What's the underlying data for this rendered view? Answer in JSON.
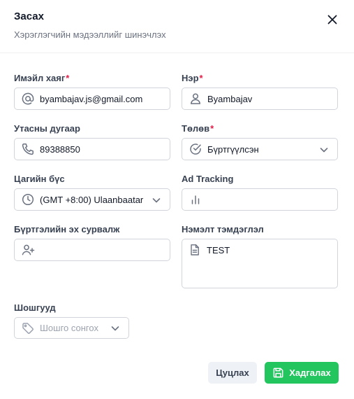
{
  "dialog": {
    "title": "Засах",
    "subtitle": "Хэрэглэгчийн мэдээллийг шинэчлэх"
  },
  "form": {
    "email": {
      "label": "Имэйл хаяг",
      "required": "*",
      "value": "byambajav.js@gmail.com",
      "icon": "at-sign-icon"
    },
    "name": {
      "label": "Нэр",
      "required": "*",
      "value": "Byambajav",
      "icon": "user-icon"
    },
    "phone": {
      "label": "Утасны дугаар",
      "value": "89388850",
      "icon": "phone-icon"
    },
    "status": {
      "label": "Төлөв",
      "required": "*",
      "value": "Бүртгүүлсэн",
      "icon": "check-circle-icon"
    },
    "timezone": {
      "label": "Цагийн бүс",
      "value": "(GMT +8:00) Ulaanbaatar",
      "icon": "clock-icon"
    },
    "ad_tracking": {
      "label": "Ad Tracking",
      "value": "",
      "icon": "bar-chart-icon"
    },
    "source": {
      "label": "Бүртгэлийн эх сурвалж",
      "value": "",
      "icon": "user-plus-icon"
    },
    "notes": {
      "label": "Нэмэлт тэмдэглэл",
      "value": "TEST",
      "icon": "document-icon"
    },
    "tags": {
      "label": "Шошгууд",
      "placeholder": "Шошго сонгох",
      "icon": "tag-icon"
    }
  },
  "actions": {
    "cancel_label": "Цуцлах",
    "save_label": "Хадгалах"
  },
  "colors": {
    "accent": "#22c55e",
    "required": "#e11d48",
    "border": "#d1d5db"
  }
}
